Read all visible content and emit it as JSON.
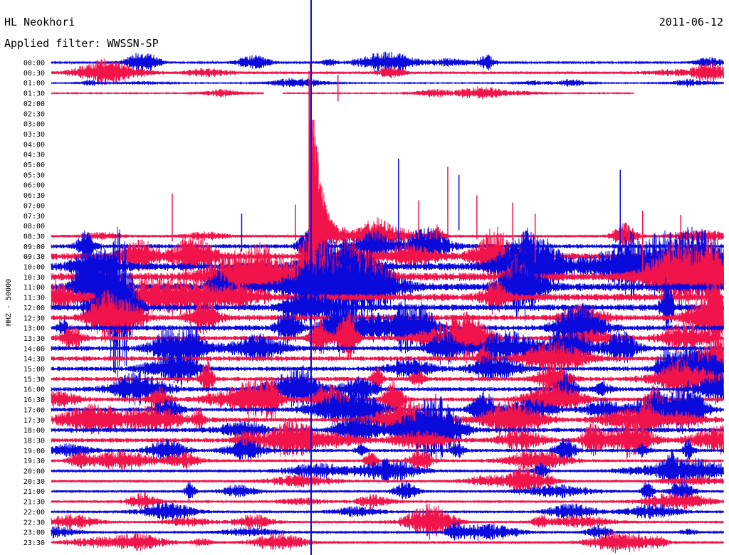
{
  "header": {
    "station": "HL Neokhori",
    "date": "2011-06-12",
    "filter": "Applied filter: WWSSN-SP"
  },
  "channel_label": "HHZ - 50000",
  "colors": {
    "trace_a": "#0a0adc",
    "trace_b": "#f0144b",
    "background": "#ffffff"
  },
  "chart_data": {
    "type": "line",
    "title": "HL Neokhori",
    "ylabel": "HHZ - 50000",
    "row_labels": [
      "00:00",
      "00:30",
      "01:00",
      "01:30",
      "02:00",
      "02:30",
      "03:00",
      "03:30",
      "04:00",
      "04:30",
      "05:00",
      "05:30",
      "06:00",
      "06:30",
      "07:00",
      "07:30",
      "08:00",
      "08:30",
      "09:00",
      "09:30",
      "10:00",
      "10:30",
      "11:00",
      "11:30",
      "12:00",
      "12:30",
      "13:00",
      "13:30",
      "14:00",
      "14:30",
      "15:00",
      "15:30",
      "16:00",
      "16:30",
      "17:00",
      "17:30",
      "18:00",
      "18:30",
      "19:00",
      "19:30",
      "20:00",
      "20:30",
      "21:00",
      "21:30",
      "22:00",
      "22:30",
      "23:00",
      "23:30"
    ],
    "row_colors": [
      "blue",
      "red"
    ],
    "rows_with_data": [
      0,
      1,
      2,
      3,
      17,
      18,
      19,
      20,
      21,
      22,
      23,
      24,
      25,
      26,
      27,
      28,
      29,
      30,
      31,
      32,
      33,
      34,
      35,
      36,
      37,
      38,
      39,
      40,
      41,
      42,
      43,
      44,
      45,
      46,
      47
    ],
    "row_amplitude": [
      0.35,
      0.45,
      0.2,
      0.2,
      0,
      0,
      0,
      0,
      0,
      0,
      0,
      0,
      0,
      0,
      0,
      0,
      0,
      0.5,
      0.9,
      1.4,
      1.6,
      1.7,
      1.6,
      1.5,
      1.3,
      1.2,
      1.1,
      1.0,
      1.0,
      1.0,
      0.9,
      0.9,
      0.9,
      0.9,
      0.9,
      1.0,
      1.0,
      0.9,
      0.7,
      0.6,
      0.6,
      0.5,
      0.5,
      0.5,
      0.5,
      0.45,
      0.4,
      0.4
    ],
    "row_coverage": [
      {
        "row": 1,
        "end_minute": 30
      },
      {
        "row": 3,
        "end_minute": 26
      }
    ],
    "gap": {
      "row": 3,
      "start_minute": 9.5,
      "end_minute": 10.3
    },
    "spikes": [
      {
        "row": 3,
        "minute": 12.8,
        "up": 1.8,
        "down": 0.8
      },
      {
        "row": 17,
        "minute": 11.9,
        "up": 8.3,
        "down": 0.3
      },
      {
        "row": 18,
        "minute": 15.5,
        "up": 8.6,
        "down": 0.5
      },
      {
        "row": 17,
        "minute": 17.7,
        "up": 6.8,
        "down": 0.3
      },
      {
        "row": 17,
        "minute": 19.0,
        "up": 4.0,
        "down": 0.3
      },
      {
        "row": 19,
        "minute": 21.6,
        "up": 4.2,
        "down": 0.6
      },
      {
        "row": 19,
        "minute": 26.4,
        "up": 4.5,
        "down": 1.5
      },
      {
        "row": 18,
        "minute": 25.4,
        "up": 7.5,
        "down": 0.5
      },
      {
        "row": 17,
        "minute": 5.4,
        "up": 4.2,
        "down": 0.5
      },
      {
        "row": 18,
        "minute": 8.5,
        "up": 3.2,
        "down": 0.5
      },
      {
        "row": 17,
        "minute": 10.9,
        "up": 3.1,
        "down": 0.4
      },
      {
        "row": 17,
        "minute": 20.6,
        "up": 3.3,
        "down": 0.4
      },
      {
        "row": 17,
        "minute": 16.4,
        "up": 3.5,
        "down": 0.3
      },
      {
        "row": 17,
        "minute": 28.1,
        "up": 2.1,
        "down": 0.4
      },
      {
        "row": 16,
        "minute": 18.2,
        "up": 5.0,
        "down": 0.4
      }
    ],
    "major_event": {
      "row": 17,
      "minute": 11.5,
      "peak_up": 22.0,
      "coda_minutes": 1.3
    },
    "vertical_line": {
      "minute": 11.6,
      "from_row": 0,
      "to_row": 47
    }
  }
}
